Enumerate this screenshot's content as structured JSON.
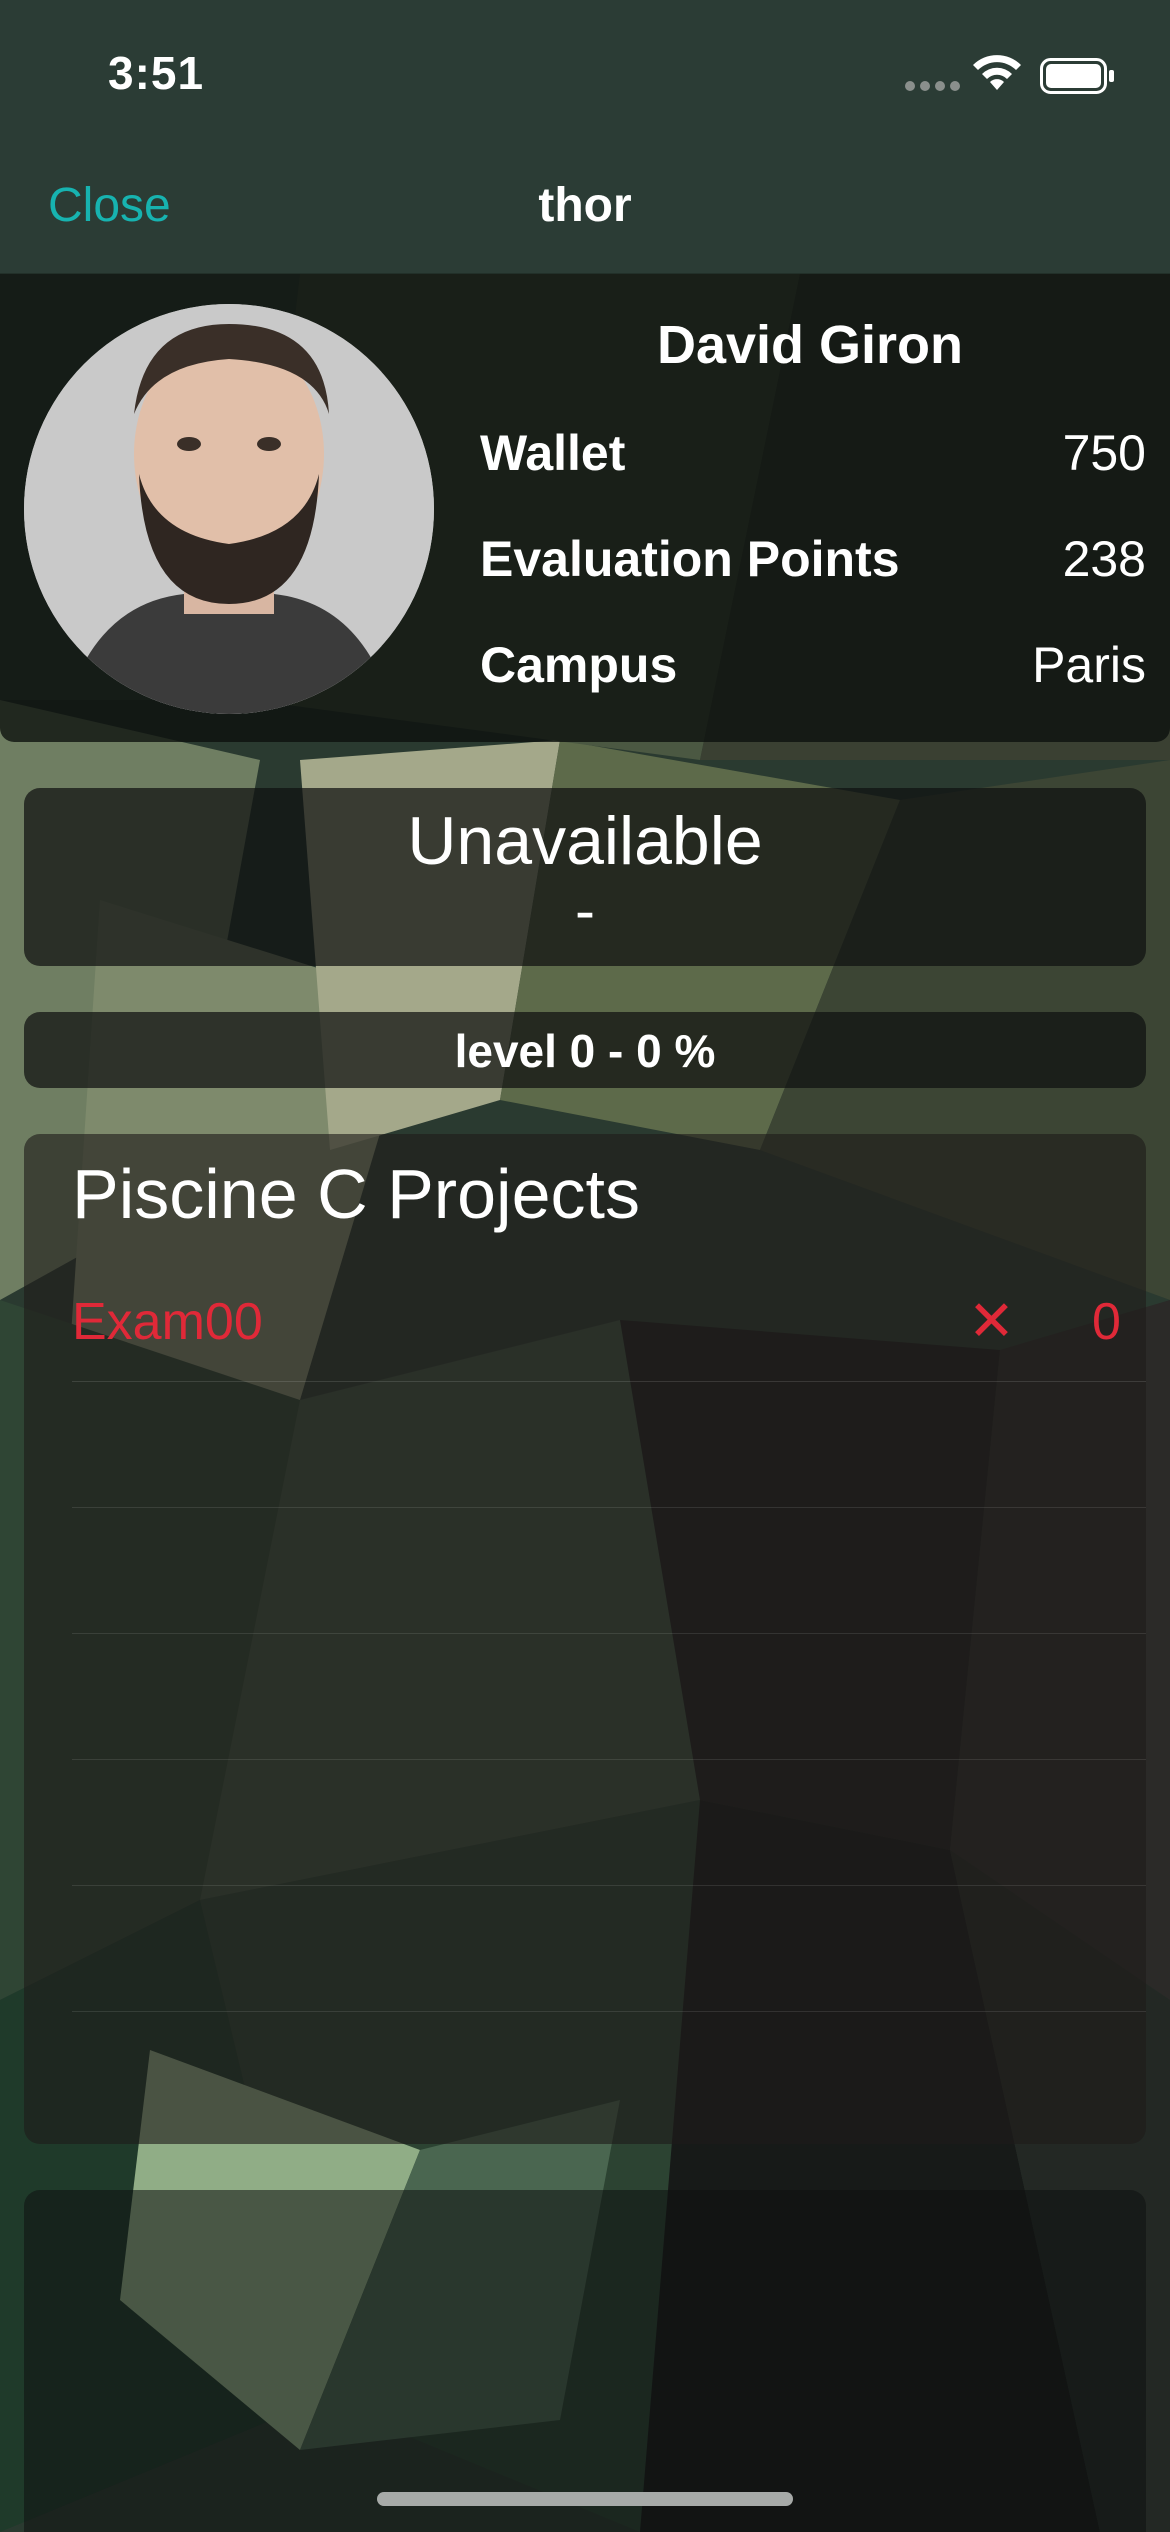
{
  "status_bar": {
    "time": "3:51",
    "signal_icon": "signal-dots-icon",
    "wifi_icon": "wifi-icon",
    "battery_icon": "battery-icon"
  },
  "nav": {
    "close_label": "Close",
    "title": "thor"
  },
  "profile": {
    "name": "David Giron",
    "avatar": "user-photo",
    "stats": [
      {
        "label": "Wallet",
        "value": "750"
      },
      {
        "label": "Evaluation Points",
        "value": "238"
      },
      {
        "label": "Campus",
        "value": "Paris"
      }
    ]
  },
  "availability": {
    "status": "Unavailable",
    "host": "-"
  },
  "level": {
    "text": "level 0 - 0 %"
  },
  "projects": {
    "title": "Piscine C Projects",
    "items": [
      {
        "name": "Exam00",
        "status_icon": "x-icon",
        "status_symbol": "✕",
        "grade": "0"
      }
    ]
  },
  "colors": {
    "accent": "#17b3b0",
    "fail": "#e02938",
    "nav_background": "#2b3c35"
  }
}
